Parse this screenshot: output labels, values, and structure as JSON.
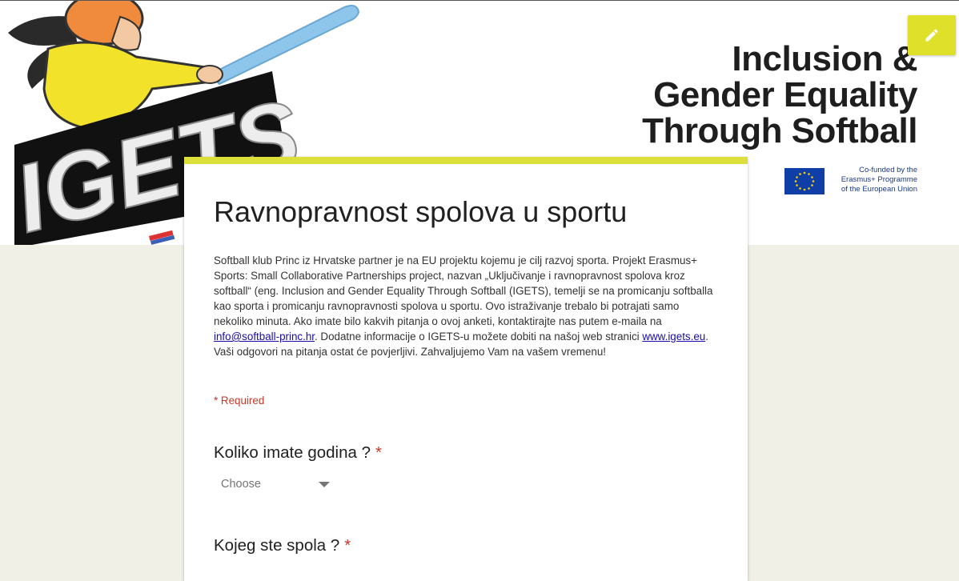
{
  "banner": {
    "logo_text": "IGETS",
    "logo_tagline": "Inclusion & Gender Equality",
    "title_lines": [
      "Inclusion &",
      "Gender Equality",
      "Through Softball"
    ],
    "eu_text_lines": [
      "Co-funded by the",
      "Erasmus+ Programme",
      "of the European Union"
    ]
  },
  "colors": {
    "accent": "#dbe03a",
    "edit_button": "#dfe02a",
    "page_background": "#f0f0e6",
    "required": "#c53929",
    "link": "#1a0dab",
    "eu_blue": "#0f3ea6"
  },
  "icons": {
    "edit": "pencil-icon",
    "dropdown": "triangle-down-icon",
    "eu_flag": "eu-flag-icon"
  },
  "form": {
    "title": "Ravnopravnost spolova u sportu",
    "description": {
      "part1": "Softball klub Princ iz Hrvatske partner je na EU projektu kojemu je cilj razvoj sporta. Projekt Erasmus+ Sports: Small Collaborative Partnerships project, nazvan „Uključivanje i ravnopravnost spolova kroz softball“ (eng. Inclusion and Gender Equality Through Softball (IGETS), temelji se na promicanju softballa kao sporta i promicanju ravnopravnosti spolova u sportu. Ovo istraživanje trebalo bi potrajati samo nekoliko minuta. Ako imate bilo kakvih pitanja o ovoj anketi, kontaktirajte nas putem e-maila na ",
      "email": "info@softball-princ.hr",
      "part2": ". Dodatne informacije o IGETS-u možete dobiti na našoj web stranici ",
      "website": "www.igets.eu",
      "part3": ". Vaši odgovori na  pitanja ostat će povjerljivi. Zahvaljujemo Vam na vašem vremenu!"
    },
    "required_note": "* Required",
    "questions": [
      {
        "label": "Koliko imate godina ?",
        "required_mark": "*",
        "select_value": "Choose"
      },
      {
        "label": "Kojeg ste spola ?",
        "required_mark": "*"
      }
    ]
  }
}
